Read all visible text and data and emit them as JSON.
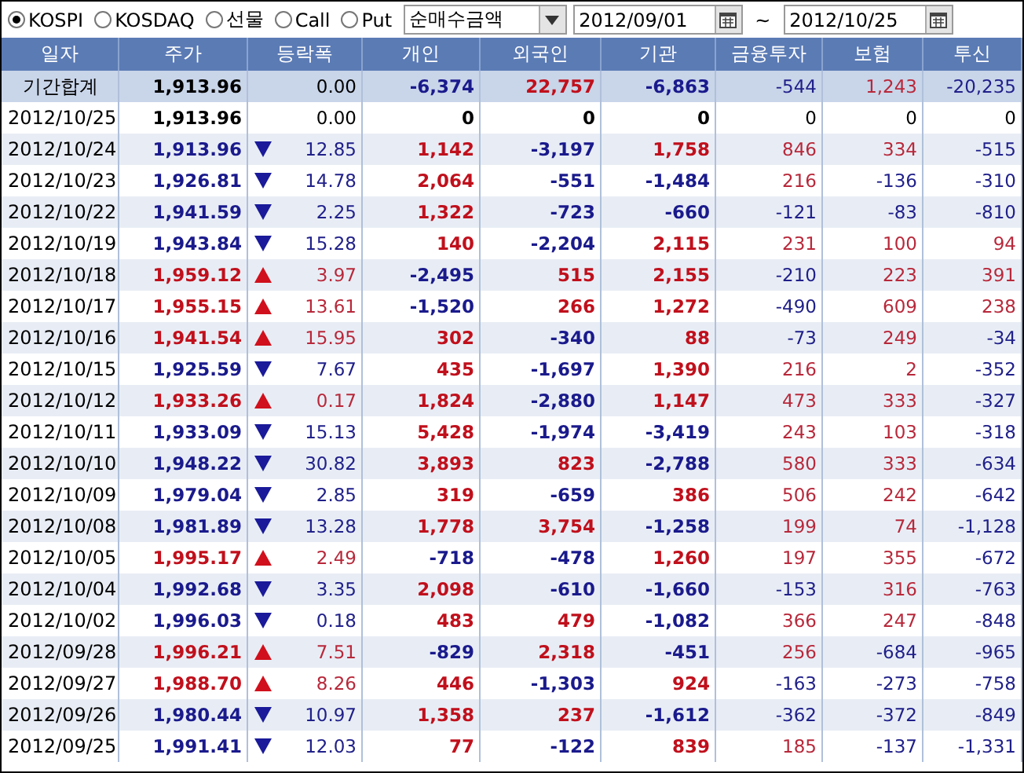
{
  "market_options": [
    {
      "label": "KOSPI",
      "selected": true
    },
    {
      "label": "KOSDAQ",
      "selected": false
    },
    {
      "label": "선물",
      "selected": false
    },
    {
      "label": "Call",
      "selected": false
    },
    {
      "label": "Put",
      "selected": false
    }
  ],
  "measure_dropdown": {
    "value": "순매수금액"
  },
  "date_range": {
    "start": "2012/09/01",
    "separator": "~",
    "end": "2012/10/25"
  },
  "table": {
    "columns": [
      "일자",
      "주가",
      "등락폭",
      "개인",
      "외국인",
      "기관",
      "금융투자",
      "보험",
      "투신"
    ],
    "rows": [
      {
        "kind": "total",
        "date": "기간합계",
        "price": {
          "value": "1,913.96",
          "color": "#000000"
        },
        "up": false,
        "down": false,
        "change": {
          "value": "0.00",
          "color": "#000000"
        },
        "flows": [
          {
            "value": "-6,374",
            "color": "#1a1a8c"
          },
          {
            "value": "22,757",
            "color": "#c0101c"
          },
          {
            "value": "-6,863",
            "color": "#1a1a8c"
          },
          {
            "value": "-544",
            "color": "#20208a"
          },
          {
            "value": "1,243",
            "color": "#b8283a"
          },
          {
            "value": "-20,235",
            "color": "#20208a"
          }
        ]
      },
      {
        "kind": "day",
        "date": "2012/10/25",
        "price": {
          "value": "1,913.96",
          "color": "#000000"
        },
        "up": false,
        "down": false,
        "change": {
          "value": "0.00",
          "color": "#000000"
        },
        "flows": [
          {
            "value": "0",
            "color": "#000000"
          },
          {
            "value": "0",
            "color": "#000000"
          },
          {
            "value": "0",
            "color": "#000000"
          },
          {
            "value": "0",
            "color": "#000000"
          },
          {
            "value": "0",
            "color": "#000000"
          },
          {
            "value": "0",
            "color": "#000000"
          }
        ]
      },
      {
        "kind": "day",
        "date": "2012/10/24",
        "price": {
          "value": "1,913.96",
          "color": "#1a1a8c"
        },
        "up": false,
        "down": true,
        "change": {
          "value": "12.85",
          "color": "#20208a"
        },
        "flows": [
          {
            "value": "1,142",
            "color": "#c0101c"
          },
          {
            "value": "-3,197",
            "color": "#1a1a8c"
          },
          {
            "value": "1,758",
            "color": "#c0101c"
          },
          {
            "value": "846",
            "color": "#b8283a"
          },
          {
            "value": "334",
            "color": "#b8283a"
          },
          {
            "value": "-515",
            "color": "#20208a"
          }
        ]
      },
      {
        "kind": "day",
        "date": "2012/10/23",
        "price": {
          "value": "1,926.81",
          "color": "#1a1a8c"
        },
        "up": false,
        "down": true,
        "change": {
          "value": "14.78",
          "color": "#20208a"
        },
        "flows": [
          {
            "value": "2,064",
            "color": "#c0101c"
          },
          {
            "value": "-551",
            "color": "#1a1a8c"
          },
          {
            "value": "-1,484",
            "color": "#1a1a8c"
          },
          {
            "value": "216",
            "color": "#b8283a"
          },
          {
            "value": "-136",
            "color": "#20208a"
          },
          {
            "value": "-310",
            "color": "#20208a"
          }
        ]
      },
      {
        "kind": "day",
        "date": "2012/10/22",
        "price": {
          "value": "1,941.59",
          "color": "#1a1a8c"
        },
        "up": false,
        "down": true,
        "change": {
          "value": "2.25",
          "color": "#20208a"
        },
        "flows": [
          {
            "value": "1,322",
            "color": "#c0101c"
          },
          {
            "value": "-723",
            "color": "#1a1a8c"
          },
          {
            "value": "-660",
            "color": "#1a1a8c"
          },
          {
            "value": "-121",
            "color": "#20208a"
          },
          {
            "value": "-83",
            "color": "#20208a"
          },
          {
            "value": "-810",
            "color": "#20208a"
          }
        ]
      },
      {
        "kind": "day",
        "date": "2012/10/19",
        "price": {
          "value": "1,943.84",
          "color": "#1a1a8c"
        },
        "up": false,
        "down": true,
        "change": {
          "value": "15.28",
          "color": "#20208a"
        },
        "flows": [
          {
            "value": "140",
            "color": "#c0101c"
          },
          {
            "value": "-2,204",
            "color": "#1a1a8c"
          },
          {
            "value": "2,115",
            "color": "#c0101c"
          },
          {
            "value": "231",
            "color": "#b8283a"
          },
          {
            "value": "100",
            "color": "#b8283a"
          },
          {
            "value": "94",
            "color": "#b8283a"
          }
        ]
      },
      {
        "kind": "day",
        "date": "2012/10/18",
        "price": {
          "value": "1,959.12",
          "color": "#c0101c"
        },
        "up": true,
        "down": false,
        "change": {
          "value": "3.97",
          "color": "#b8283a"
        },
        "flows": [
          {
            "value": "-2,495",
            "color": "#1a1a8c"
          },
          {
            "value": "515",
            "color": "#c0101c"
          },
          {
            "value": "2,155",
            "color": "#c0101c"
          },
          {
            "value": "-210",
            "color": "#20208a"
          },
          {
            "value": "223",
            "color": "#b8283a"
          },
          {
            "value": "391",
            "color": "#b8283a"
          }
        ]
      },
      {
        "kind": "day",
        "date": "2012/10/17",
        "price": {
          "value": "1,955.15",
          "color": "#c0101c"
        },
        "up": true,
        "down": false,
        "change": {
          "value": "13.61",
          "color": "#b8283a"
        },
        "flows": [
          {
            "value": "-1,520",
            "color": "#1a1a8c"
          },
          {
            "value": "266",
            "color": "#c0101c"
          },
          {
            "value": "1,272",
            "color": "#c0101c"
          },
          {
            "value": "-490",
            "color": "#20208a"
          },
          {
            "value": "609",
            "color": "#b8283a"
          },
          {
            "value": "238",
            "color": "#b8283a"
          }
        ]
      },
      {
        "kind": "day",
        "date": "2012/10/16",
        "price": {
          "value": "1,941.54",
          "color": "#c0101c"
        },
        "up": true,
        "down": false,
        "change": {
          "value": "15.95",
          "color": "#b8283a"
        },
        "flows": [
          {
            "value": "302",
            "color": "#c0101c"
          },
          {
            "value": "-340",
            "color": "#1a1a8c"
          },
          {
            "value": "88",
            "color": "#c0101c"
          },
          {
            "value": "-73",
            "color": "#20208a"
          },
          {
            "value": "249",
            "color": "#b8283a"
          },
          {
            "value": "-34",
            "color": "#20208a"
          }
        ]
      },
      {
        "kind": "day",
        "date": "2012/10/15",
        "price": {
          "value": "1,925.59",
          "color": "#1a1a8c"
        },
        "up": false,
        "down": true,
        "change": {
          "value": "7.67",
          "color": "#20208a"
        },
        "flows": [
          {
            "value": "435",
            "color": "#c0101c"
          },
          {
            "value": "-1,697",
            "color": "#1a1a8c"
          },
          {
            "value": "1,390",
            "color": "#c0101c"
          },
          {
            "value": "216",
            "color": "#b8283a"
          },
          {
            "value": "2",
            "color": "#b8283a"
          },
          {
            "value": "-352",
            "color": "#20208a"
          }
        ]
      },
      {
        "kind": "day",
        "date": "2012/10/12",
        "price": {
          "value": "1,933.26",
          "color": "#c0101c"
        },
        "up": true,
        "down": false,
        "change": {
          "value": "0.17",
          "color": "#b8283a"
        },
        "flows": [
          {
            "value": "1,824",
            "color": "#c0101c"
          },
          {
            "value": "-2,880",
            "color": "#1a1a8c"
          },
          {
            "value": "1,147",
            "color": "#c0101c"
          },
          {
            "value": "473",
            "color": "#b8283a"
          },
          {
            "value": "333",
            "color": "#b8283a"
          },
          {
            "value": "-327",
            "color": "#20208a"
          }
        ]
      },
      {
        "kind": "day",
        "date": "2012/10/11",
        "price": {
          "value": "1,933.09",
          "color": "#1a1a8c"
        },
        "up": false,
        "down": true,
        "change": {
          "value": "15.13",
          "color": "#20208a"
        },
        "flows": [
          {
            "value": "5,428",
            "color": "#c0101c"
          },
          {
            "value": "-1,974",
            "color": "#1a1a8c"
          },
          {
            "value": "-3,419",
            "color": "#1a1a8c"
          },
          {
            "value": "243",
            "color": "#b8283a"
          },
          {
            "value": "103",
            "color": "#b8283a"
          },
          {
            "value": "-318",
            "color": "#20208a"
          }
        ]
      },
      {
        "kind": "day",
        "date": "2012/10/10",
        "price": {
          "value": "1,948.22",
          "color": "#1a1a8c"
        },
        "up": false,
        "down": true,
        "change": {
          "value": "30.82",
          "color": "#20208a"
        },
        "flows": [
          {
            "value": "3,893",
            "color": "#c0101c"
          },
          {
            "value": "823",
            "color": "#c0101c"
          },
          {
            "value": "-2,788",
            "color": "#1a1a8c"
          },
          {
            "value": "580",
            "color": "#b8283a"
          },
          {
            "value": "333",
            "color": "#b8283a"
          },
          {
            "value": "-634",
            "color": "#20208a"
          }
        ]
      },
      {
        "kind": "day",
        "date": "2012/10/09",
        "price": {
          "value": "1,979.04",
          "color": "#1a1a8c"
        },
        "up": false,
        "down": true,
        "change": {
          "value": "2.85",
          "color": "#20208a"
        },
        "flows": [
          {
            "value": "319",
            "color": "#c0101c"
          },
          {
            "value": "-659",
            "color": "#1a1a8c"
          },
          {
            "value": "386",
            "color": "#c0101c"
          },
          {
            "value": "506",
            "color": "#b8283a"
          },
          {
            "value": "242",
            "color": "#b8283a"
          },
          {
            "value": "-642",
            "color": "#20208a"
          }
        ]
      },
      {
        "kind": "day",
        "date": "2012/10/08",
        "price": {
          "value": "1,981.89",
          "color": "#1a1a8c"
        },
        "up": false,
        "down": true,
        "change": {
          "value": "13.28",
          "color": "#20208a"
        },
        "flows": [
          {
            "value": "1,778",
            "color": "#c0101c"
          },
          {
            "value": "3,754",
            "color": "#c0101c"
          },
          {
            "value": "-1,258",
            "color": "#1a1a8c"
          },
          {
            "value": "199",
            "color": "#b8283a"
          },
          {
            "value": "74",
            "color": "#b8283a"
          },
          {
            "value": "-1,128",
            "color": "#20208a"
          }
        ]
      },
      {
        "kind": "day",
        "date": "2012/10/05",
        "price": {
          "value": "1,995.17",
          "color": "#c0101c"
        },
        "up": true,
        "down": false,
        "change": {
          "value": "2.49",
          "color": "#b8283a"
        },
        "flows": [
          {
            "value": "-718",
            "color": "#1a1a8c"
          },
          {
            "value": "-478",
            "color": "#1a1a8c"
          },
          {
            "value": "1,260",
            "color": "#c0101c"
          },
          {
            "value": "197",
            "color": "#b8283a"
          },
          {
            "value": "355",
            "color": "#b8283a"
          },
          {
            "value": "-672",
            "color": "#20208a"
          }
        ]
      },
      {
        "kind": "day",
        "date": "2012/10/04",
        "price": {
          "value": "1,992.68",
          "color": "#1a1a8c"
        },
        "up": false,
        "down": true,
        "change": {
          "value": "3.35",
          "color": "#20208a"
        },
        "flows": [
          {
            "value": "2,098",
            "color": "#c0101c"
          },
          {
            "value": "-610",
            "color": "#1a1a8c"
          },
          {
            "value": "-1,660",
            "color": "#1a1a8c"
          },
          {
            "value": "-153",
            "color": "#20208a"
          },
          {
            "value": "316",
            "color": "#b8283a"
          },
          {
            "value": "-763",
            "color": "#20208a"
          }
        ]
      },
      {
        "kind": "day",
        "date": "2012/10/02",
        "price": {
          "value": "1,996.03",
          "color": "#1a1a8c"
        },
        "up": false,
        "down": true,
        "change": {
          "value": "0.18",
          "color": "#20208a"
        },
        "flows": [
          {
            "value": "483",
            "color": "#c0101c"
          },
          {
            "value": "479",
            "color": "#c0101c"
          },
          {
            "value": "-1,082",
            "color": "#1a1a8c"
          },
          {
            "value": "366",
            "color": "#b8283a"
          },
          {
            "value": "247",
            "color": "#b8283a"
          },
          {
            "value": "-848",
            "color": "#20208a"
          }
        ]
      },
      {
        "kind": "day",
        "date": "2012/09/28",
        "price": {
          "value": "1,996.21",
          "color": "#c0101c"
        },
        "up": true,
        "down": false,
        "change": {
          "value": "7.51",
          "color": "#b8283a"
        },
        "flows": [
          {
            "value": "-829",
            "color": "#1a1a8c"
          },
          {
            "value": "2,318",
            "color": "#c0101c"
          },
          {
            "value": "-451",
            "color": "#1a1a8c"
          },
          {
            "value": "256",
            "color": "#b8283a"
          },
          {
            "value": "-684",
            "color": "#20208a"
          },
          {
            "value": "-965",
            "color": "#20208a"
          }
        ]
      },
      {
        "kind": "day",
        "date": "2012/09/27",
        "price": {
          "value": "1,988.70",
          "color": "#c0101c"
        },
        "up": true,
        "down": false,
        "change": {
          "value": "8.26",
          "color": "#b8283a"
        },
        "flows": [
          {
            "value": "446",
            "color": "#c0101c"
          },
          {
            "value": "-1,303",
            "color": "#1a1a8c"
          },
          {
            "value": "924",
            "color": "#c0101c"
          },
          {
            "value": "-163",
            "color": "#20208a"
          },
          {
            "value": "-273",
            "color": "#20208a"
          },
          {
            "value": "-758",
            "color": "#20208a"
          }
        ]
      },
      {
        "kind": "day",
        "date": "2012/09/26",
        "price": {
          "value": "1,980.44",
          "color": "#1a1a8c"
        },
        "up": false,
        "down": true,
        "change": {
          "value": "10.97",
          "color": "#20208a"
        },
        "flows": [
          {
            "value": "1,358",
            "color": "#c0101c"
          },
          {
            "value": "237",
            "color": "#c0101c"
          },
          {
            "value": "-1,612",
            "color": "#1a1a8c"
          },
          {
            "value": "-362",
            "color": "#20208a"
          },
          {
            "value": "-372",
            "color": "#20208a"
          },
          {
            "value": "-849",
            "color": "#20208a"
          }
        ]
      },
      {
        "kind": "day",
        "date": "2012/09/25",
        "price": {
          "value": "1,991.41",
          "color": "#1a1a8c"
        },
        "up": false,
        "down": true,
        "change": {
          "value": "12.03",
          "color": "#20208a"
        },
        "flows": [
          {
            "value": "77",
            "color": "#c0101c"
          },
          {
            "value": "-122",
            "color": "#1a1a8c"
          },
          {
            "value": "839",
            "color": "#c0101c"
          },
          {
            "value": "185",
            "color": "#b8283a"
          },
          {
            "value": "-137",
            "color": "#20208a"
          },
          {
            "value": "-1,331",
            "color": "#20208a"
          }
        ]
      }
    ]
  }
}
